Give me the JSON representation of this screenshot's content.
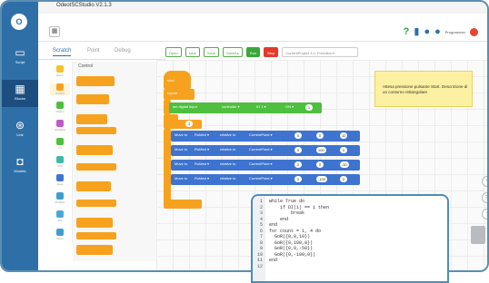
{
  "app": {
    "title": "OdeotSCStudio V2.1.3",
    "logo_letter": "O"
  },
  "rail": [
    {
      "label": "Script",
      "icon": "monitor-icon",
      "glyph": "▭",
      "active": false
    },
    {
      "label": "Blocks",
      "icon": "blocks-icon",
      "glyph": "▦",
      "active": true
    },
    {
      "label": "Link",
      "icon": "link-icon",
      "glyph": "⊛",
      "active": false
    },
    {
      "label": "Models",
      "icon": "chip-icon",
      "glyph": "◘",
      "active": false
    }
  ],
  "header": {
    "user_name": "Programmer",
    "help_glyph": "?",
    "book_glyph": "▮",
    "user_glyph": "●"
  },
  "tabs": [
    "Scratch",
    "Point",
    "Debug"
  ],
  "actions": {
    "open": "Open",
    "new": "New",
    "save": "Save",
    "saveas": "SaveAs",
    "run": "Run",
    "stop": "Stop",
    "file": "CurrentProject 1.h. Freeditor.h"
  },
  "categories": {
    "title": "Control",
    "items": [
      {
        "label": "Event",
        "color": "#f6c02e"
      },
      {
        "label": "Control",
        "color": "#f6a21e"
      },
      {
        "label": "Motion",
        "color": "#4fbf40"
      },
      {
        "label": "Variables",
        "color": "#c058c8"
      },
      {
        "label": "IO",
        "color": "#4fbf40"
      },
      {
        "label": "Joint",
        "color": "#3eb8a8"
      },
      {
        "label": "Axes",
        "color": "#3e74cf"
      },
      {
        "label": "Position",
        "color": "#3e9ecf"
      },
      {
        "label": "Tool",
        "color": "#4aa8d8"
      },
      {
        "label": "Vision",
        "color": "#3e9ecf"
      }
    ]
  },
  "workspace": {
    "start_label": "start",
    "repeat_label": "repeat",
    "set_block": {
      "label": "set digital input",
      "dropdown": "controller ▾",
      "value1": "IO 1 ▾",
      "value2": "ON ▾",
      "pill": "1"
    },
    "count_pill": "4",
    "move_rows": [
      {
        "label": "Move to",
        "robot": "RoMed ▾",
        "mode": "relative to",
        "point": "CurrentPoint ▾",
        "x": "0",
        "y": "0",
        "z": "10"
      },
      {
        "label": "Move to",
        "robot": "RoMed ▾",
        "mode": "relative to",
        "point": "CurrentPoint ▾",
        "x": "0",
        "y": "100",
        "z": "0"
      },
      {
        "label": "Move to",
        "robot": "RoMed ▾",
        "mode": "relative to",
        "point": "CurrentPoint ▾",
        "x": "0",
        "y": "0",
        "z": "-50"
      },
      {
        "label": "Move to",
        "robot": "RoMed ▾",
        "mode": "relative to",
        "point": "CurrentPoint ▾",
        "x": "0",
        "y": "-100",
        "z": "0"
      }
    ],
    "note": "Attesa pressione pulsante Start. Descrizione di un contorno rettangolare"
  },
  "code": {
    "lines": [
      {
        "n": "1",
        "t": "while True do"
      },
      {
        "n": "2",
        "t": "    if DI(1) == 1 then"
      },
      {
        "n": "3",
        "t": "        break"
      },
      {
        "n": "4",
        "t": "    end"
      },
      {
        "n": "5",
        "t": "end"
      },
      {
        "n": "6",
        "t": "for count = 1, 4 do"
      },
      {
        "n": "7",
        "t": "  GoR({0,0,10})"
      },
      {
        "n": "8",
        "t": "  GoR({0,100,0})"
      },
      {
        "n": "9",
        "t": "  GoR({0,0,-50})"
      },
      {
        "n": "10",
        "t": "  GoR({0,-100,0})"
      },
      {
        "n": "11",
        "t": "end"
      },
      {
        "n": "12",
        "t": ""
      }
    ]
  },
  "zoom": {
    "in": "+",
    "reset": "=",
    "out": "−"
  }
}
